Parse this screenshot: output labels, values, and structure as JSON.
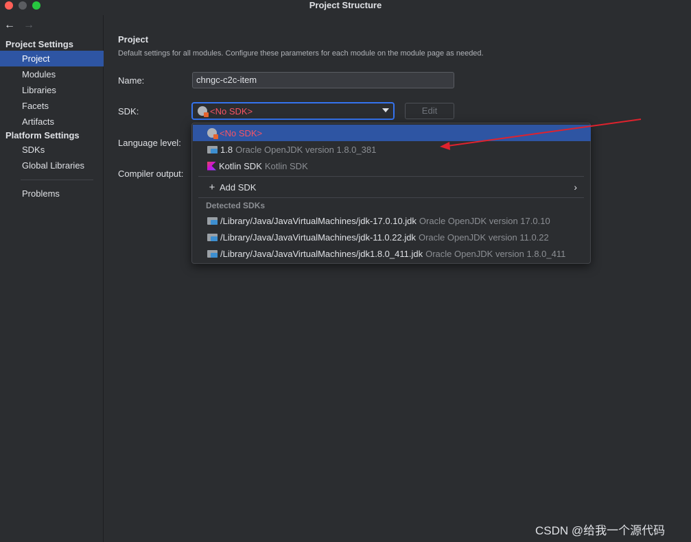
{
  "window": {
    "title": "Project Structure"
  },
  "sidebar": {
    "groups": [
      {
        "title": "Project Settings",
        "items": [
          "Project",
          "Modules",
          "Libraries",
          "Facets",
          "Artifacts"
        ]
      },
      {
        "title": "Platform Settings",
        "items": [
          "SDKs",
          "Global Libraries"
        ]
      }
    ],
    "extra_item": "Problems",
    "selected": "Project"
  },
  "main": {
    "title": "Project",
    "description": "Default settings for all modules. Configure these parameters for each module on the module page as needed.",
    "name_label": "Name:",
    "name_value": "chngc-c2c-item",
    "sdk_label": "SDK:",
    "sdk_value": "<No SDK>",
    "edit_label": "Edit",
    "language_label": "Language level:",
    "compiler_label": "Compiler output:"
  },
  "sdk_popup": {
    "items": [
      {
        "name": "<No SDK>",
        "hint": "",
        "icon": "globe-icon",
        "selected": true
      },
      {
        "name": "1.8",
        "hint": "Oracle OpenJDK version 1.8.0_381",
        "icon": "folder-icon"
      },
      {
        "name": "Kotlin SDK",
        "hint": "Kotlin SDK",
        "icon": "kotlin-icon"
      }
    ],
    "add_sdk_label": "Add SDK",
    "detected_header": "Detected SDKs",
    "detected": [
      {
        "path": "/Library/Java/JavaVirtualMachines/jdk-17.0.10.jdk",
        "hint": "Oracle OpenJDK version 17.0.10"
      },
      {
        "path": "/Library/Java/JavaVirtualMachines/jdk-11.0.22.jdk",
        "hint": "Oracle OpenJDK version 11.0.22"
      },
      {
        "path": "/Library/Java/JavaVirtualMachines/jdk1.8.0_411.jdk",
        "hint": "Oracle OpenJDK version 1.8.0_411"
      }
    ]
  },
  "colors": {
    "accent": "#2e55a3",
    "focus": "#3574f0",
    "error": "#f75464",
    "annotation": "#e0222d"
  },
  "watermark": "CSDN @给我一个源代码"
}
